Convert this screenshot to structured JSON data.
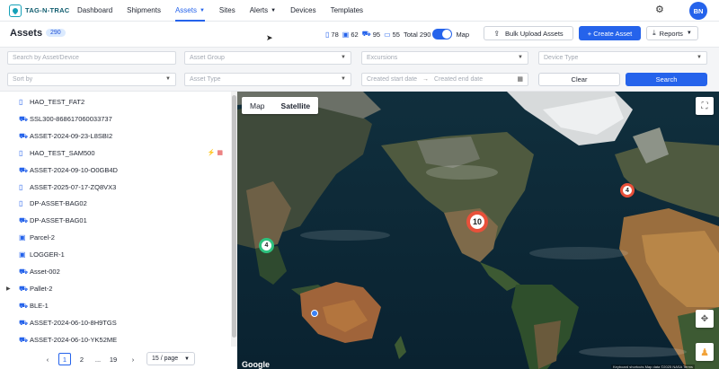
{
  "brand": {
    "name": "TAG-N-TRAC"
  },
  "nav": {
    "items": [
      {
        "label": "Dashboard"
      },
      {
        "label": "Shipments"
      },
      {
        "label": "Assets",
        "active": true
      },
      {
        "label": "Sites"
      },
      {
        "label": "Alerts"
      },
      {
        "label": "Devices"
      },
      {
        "label": "Templates"
      }
    ],
    "user_initials": "BN"
  },
  "header": {
    "title": "Assets",
    "count": "290",
    "stats": [
      "78",
      "62",
      "95",
      "55"
    ],
    "total_label": "Total 290",
    "map_toggle_label": "Map",
    "bulk_upload_label": "Bulk Upload Assets",
    "create_label": "+ Create Asset",
    "reports_label": "Reports"
  },
  "filters": {
    "search_placeholder": "Search by Asset/Device",
    "asset_group": "Asset Group",
    "excursions": "Excursions",
    "device_type": "Device Type",
    "sort_by": "Sort by",
    "asset_type": "Asset Type",
    "start_date": "Created start date",
    "end_date": "Created end date",
    "clear_label": "Clear",
    "search_label": "Search"
  },
  "assets": [
    {
      "name": "HAO_TEST_FAT2",
      "icon": "tag-icon"
    },
    {
      "name": "SSL300-868617060033737",
      "icon": "truck-icon"
    },
    {
      "name": "ASSET-2024-09-23-L8SBI2",
      "icon": "truck-icon"
    },
    {
      "name": "HAO_TEST_SAM500",
      "icon": "tag-icon",
      "tags": "⚡ ▦"
    },
    {
      "name": "ASSET-2024-09-10-O0GB4D",
      "icon": "truck-icon"
    },
    {
      "name": "ASSET-2025-07-17-ZQ8VX3",
      "icon": "tag-icon"
    },
    {
      "name": "DP-ASSET-BAG02",
      "icon": "tag-icon"
    },
    {
      "name": "DP-ASSET-BAG01",
      "icon": "truck-icon"
    },
    {
      "name": "Parcel-2",
      "icon": "box-icon"
    },
    {
      "name": "LOGGER-1",
      "icon": "box-icon"
    },
    {
      "name": "Asset-002",
      "icon": "truck-icon"
    },
    {
      "name": "Pallet-2",
      "icon": "truck-icon",
      "expandable": true
    },
    {
      "name": "BLE-1",
      "icon": "truck-icon"
    },
    {
      "name": "ASSET-2024-06-10-8H9TGS",
      "icon": "truck-icon"
    },
    {
      "name": "ASSET-2024-06-10-YK52ME",
      "icon": "truck-icon"
    }
  ],
  "pagination": {
    "pages": [
      "1",
      "2",
      "...",
      "19"
    ],
    "current": "1",
    "per_page": "15 / page"
  },
  "map": {
    "map_label": "Map",
    "satellite_label": "Satellite",
    "clusters": [
      "10",
      "4",
      "4"
    ],
    "cluster_colors": [
      "#e8503a",
      "#2ec27e"
    ],
    "google_label": "Google",
    "footer_text": "Keyboard shortcuts  Map data ©2025 NASA  Terms"
  },
  "colors": {
    "accent": "#2563eb"
  }
}
